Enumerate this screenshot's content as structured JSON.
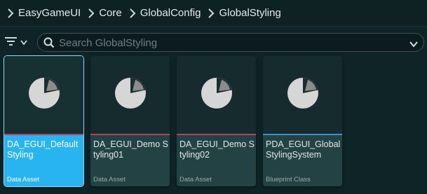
{
  "breadcrumb": {
    "items": [
      {
        "label": "EasyGameUI"
      },
      {
        "label": "Core"
      },
      {
        "label": "GlobalConfig"
      },
      {
        "label": "GlobalStyling"
      }
    ]
  },
  "search": {
    "placeholder": "Search GlobalStyling",
    "value": ""
  },
  "icons": {
    "filter": "filter-icon",
    "search": "search-icon",
    "thumbnail": "pie-chart-icon"
  },
  "colors": {
    "data_asset_bar": "#c23a5c",
    "blueprint_class_bar": "#3e8fd6",
    "selection": "#28b4f0"
  },
  "assets": [
    {
      "name": "DA_EGUI_Default Styling",
      "type": "Data Asset",
      "selected": true
    },
    {
      "name": "DA_EGUI_Demo Styling01",
      "type": "Data Asset",
      "selected": false
    },
    {
      "name": "DA_EGUI_Demo Styling02",
      "type": "Data Asset",
      "selected": false
    },
    {
      "name": "PDA_EGUI_Global StylingSystem",
      "type": "Blueprint Class",
      "selected": false
    }
  ]
}
